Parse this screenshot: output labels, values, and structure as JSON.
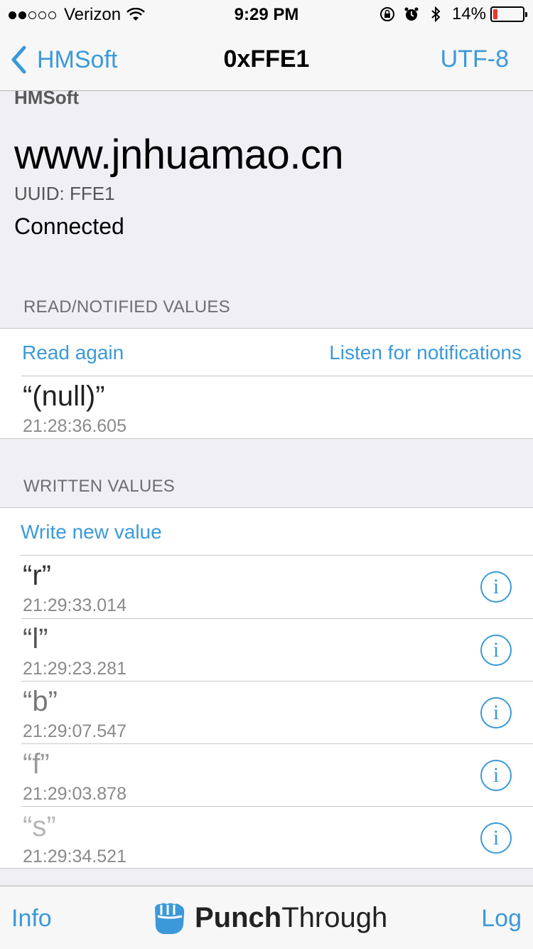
{
  "status_bar": {
    "carrier": "Verizon",
    "time": "9:29 PM",
    "battery_percent": "14%",
    "battery_level": 0.14
  },
  "nav": {
    "back_label": "HMSoft",
    "title": "0xFFE1",
    "right_label": "UTF-8"
  },
  "header": {
    "device_name": "HMSoft",
    "url": "www.jnhuamao.cn",
    "uuid": "UUID: FFE1",
    "status": "Connected"
  },
  "read_section": {
    "header": "READ/NOTIFIED VALUES",
    "read_again_label": "Read again",
    "listen_label": "Listen for notifications",
    "values": [
      {
        "value": "“(null)”",
        "time": "21:28:36.605"
      }
    ]
  },
  "written_section": {
    "header": "WRITTEN VALUES",
    "write_label": "Write new value",
    "values": [
      {
        "value": "“r”",
        "time": "21:29:33.014",
        "color": "#333333"
      },
      {
        "value": "“l”",
        "time": "21:29:23.281",
        "color": "#555555"
      },
      {
        "value": "“b”",
        "time": "21:29:07.547",
        "color": "#777777"
      },
      {
        "value": "“f”",
        "time": "21:29:03.878",
        "color": "#999999"
      },
      {
        "value": "“s”",
        "time": "21:29:34.521",
        "color": "#b5b5b5"
      }
    ],
    "info_icon_glyph": "i"
  },
  "bottom_bar": {
    "info_label": "Info",
    "log_label": "Log",
    "brand_bold": "Punch",
    "brand_thin": "Through"
  },
  "colors": {
    "accent": "#3b99d9",
    "battery_low": "#e8382f"
  }
}
